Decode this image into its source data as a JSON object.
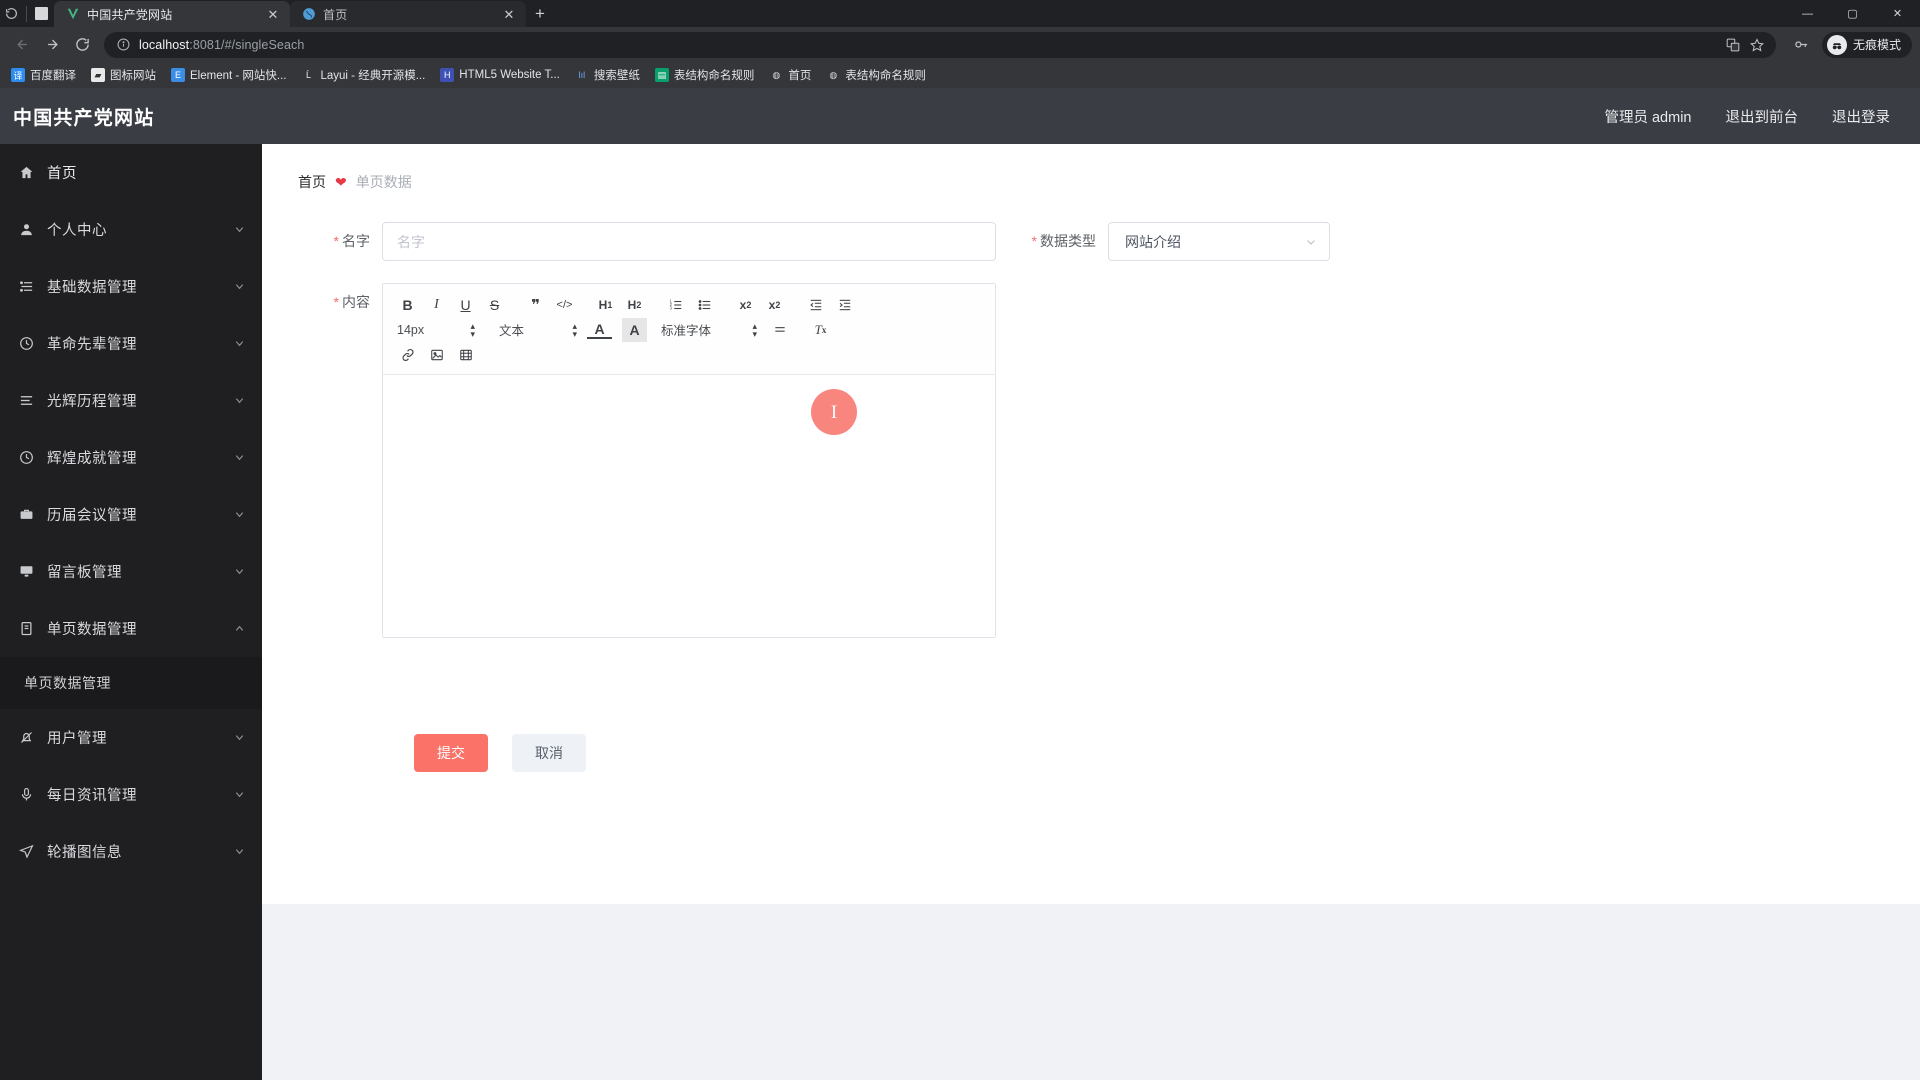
{
  "browser": {
    "tabs": [
      {
        "title": "中国共产党网站",
        "favicon": "v-logo-icon",
        "active": true
      },
      {
        "title": "首页",
        "favicon": "globe-icon",
        "active": false
      }
    ],
    "new_tab_label": "+",
    "window_controls": [
      "minimize",
      "maximize",
      "close"
    ],
    "nav": {
      "back": "←",
      "forward": "→",
      "reload": "⟳"
    },
    "omnibox": {
      "host": "localhost",
      "path": ":8081/#/singleSeach",
      "full_url": "localhost:8081/#/singleSeach",
      "info_icon": "info-circle-icon",
      "translate_icon": "translate-icon",
      "bookmark_icon": "star-icon"
    },
    "profile": {
      "key_icon": "key-icon",
      "label": "无痕模式",
      "avatar": "incognito-avatar-icon"
    },
    "bookmarks": [
      {
        "label": "百度翻译",
        "icon_color": "#2d8cf0",
        "glyph": "译"
      },
      {
        "label": "图标网站",
        "icon_color": "#f2f2f2",
        "glyph": "▰"
      },
      {
        "label": "Element - 网站快...",
        "icon_color": "#3a8ee6",
        "glyph": "E"
      },
      {
        "label": "Layui - 经典开源模...",
        "icon_color": "#2b2b2b",
        "glyph": "Ĺ"
      },
      {
        "label": "HTML5 Website T...",
        "icon_color": "#3f51b5",
        "glyph": "H"
      },
      {
        "label": "搜索壁纸",
        "icon_color": "#2b2b2b",
        "glyph": "lıl"
      },
      {
        "label": "表结构命名规则",
        "icon_color": "#0aa06e",
        "glyph": "▤"
      },
      {
        "label": "首页",
        "icon_color": "#2b2b2b",
        "glyph": "◍"
      },
      {
        "label": "表结构命名规则",
        "icon_color": "#2b2b2b",
        "glyph": "◍"
      }
    ]
  },
  "app": {
    "title": "中国共产党网站",
    "header_links": [
      "管理员 admin",
      "退出到前台",
      "退出登录"
    ]
  },
  "sidebar": {
    "items": [
      {
        "label": "首页",
        "icon": "home-icon",
        "arrow": "",
        "active": true
      },
      {
        "label": "个人中心",
        "icon": "user-icon",
        "arrow": "chevron-down-icon"
      },
      {
        "label": "基础数据管理",
        "icon": "list-icon",
        "arrow": "chevron-down-icon"
      },
      {
        "label": "革命先辈管理",
        "icon": "clock-icon",
        "arrow": "chevron-down-icon"
      },
      {
        "label": "光辉历程管理",
        "icon": "menu-icon",
        "arrow": "chevron-down-icon"
      },
      {
        "label": "辉煌成就管理",
        "icon": "clock-icon",
        "arrow": "chevron-down-icon"
      },
      {
        "label": "历届会议管理",
        "icon": "briefcase-icon",
        "arrow": "chevron-down-icon"
      },
      {
        "label": "留言板管理",
        "icon": "monitor-icon",
        "arrow": "chevron-down-icon"
      },
      {
        "label": "单页数据管理",
        "icon": "document-icon",
        "arrow": "chevron-up-icon",
        "expanded": true
      },
      {
        "label": "用户管理",
        "icon": "bell-icon",
        "arrow": "chevron-down-icon"
      },
      {
        "label": "每日资讯管理",
        "icon": "mic-icon",
        "arrow": "chevron-down-icon"
      },
      {
        "label": "轮播图信息",
        "icon": "send-icon",
        "arrow": "chevron-down-icon"
      }
    ],
    "submenu": {
      "parent_index": 8,
      "label": "单页数据管理"
    }
  },
  "breadcrumb": {
    "home": "首页",
    "separator": "❤",
    "current": "单页数据"
  },
  "form": {
    "name": {
      "label": "名字",
      "required": true,
      "value": "",
      "placeholder": "名字"
    },
    "data_type": {
      "label": "数据类型",
      "required": true,
      "value": "网站介绍",
      "caret": "chevron-down-icon"
    },
    "content": {
      "label": "内容",
      "required": true,
      "value": ""
    },
    "editor": {
      "row1": [
        {
          "name": "bold",
          "glyph": "B"
        },
        {
          "name": "italic",
          "glyph": "I"
        },
        {
          "name": "underline",
          "glyph": "U"
        },
        {
          "name": "strikethrough",
          "glyph": "S"
        },
        {
          "name": "blockquote",
          "glyph": "❞"
        },
        {
          "name": "code",
          "glyph": "</>"
        },
        {
          "name": "heading-1",
          "glyph": "H₁"
        },
        {
          "name": "heading-2",
          "glyph": "H₂"
        },
        {
          "name": "ordered-list",
          "glyph": "list-ol"
        },
        {
          "name": "bullet-list",
          "glyph": "list-ul"
        },
        {
          "name": "subscript",
          "glyph": "x₂"
        },
        {
          "name": "superscript",
          "glyph": "x²"
        },
        {
          "name": "outdent",
          "glyph": "outdent"
        },
        {
          "name": "indent",
          "glyph": "indent"
        }
      ],
      "font_size": "14px",
      "text_style": "文本",
      "font_family": "标准字体",
      "text_color": "A",
      "background_color": "A",
      "align": "align-icon",
      "clear_format": "Tx",
      "row3": [
        {
          "name": "link",
          "glyph": "🔗"
        },
        {
          "name": "image",
          "glyph": "image"
        },
        {
          "name": "video",
          "glyph": "video"
        }
      ]
    },
    "buttons": {
      "submit": "提交",
      "cancel": "取消"
    }
  },
  "colors": {
    "accent": "#fa7268",
    "sidebar_bg": "#1f1f21",
    "header_bg": "#3a3d44",
    "heart_red": "#e63946",
    "required_red": "#f56c6c"
  }
}
